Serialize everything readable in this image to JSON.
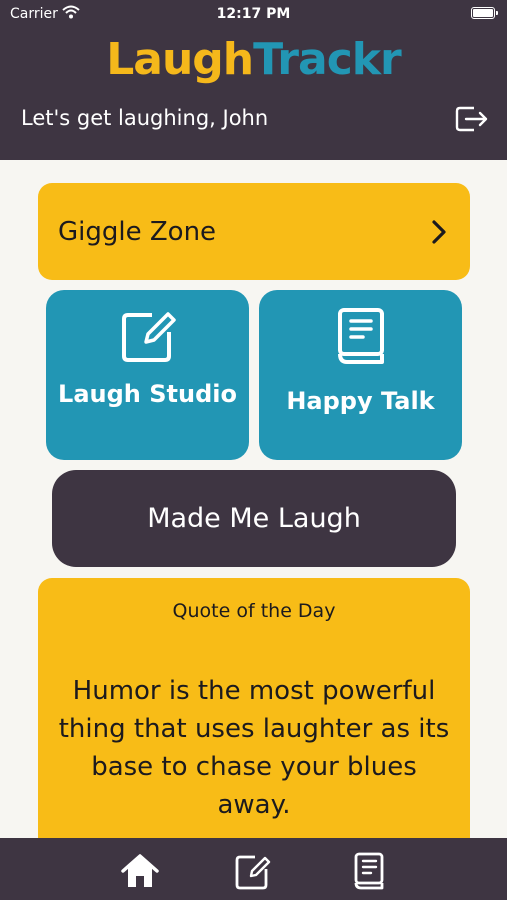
{
  "status_bar": {
    "carrier": "Carrier",
    "time": "12:17 PM",
    "icons": [
      "wifi-icon",
      "battery-icon"
    ]
  },
  "header": {
    "logo": {
      "part1": "Laugh",
      "part2": "Trackr"
    },
    "greeting": "Let's get laughing, John",
    "logout_icon": "logout-icon"
  },
  "giggle_zone": {
    "label": "Giggle Zone",
    "icon": "chevron-right-icon"
  },
  "tiles": [
    {
      "label": "Laugh Studio",
      "icon": "edit-icon"
    },
    {
      "label": "Happy Talk",
      "icon": "book-icon"
    }
  ],
  "made_me_laugh": {
    "label": "Made Me Laugh"
  },
  "quote": {
    "title": "Quote of the Day",
    "text": "Humor is the most powerful thing that uses laughter as its base to chase your blues away."
  },
  "tab_bar": {
    "items": [
      "home-icon",
      "edit-icon",
      "book-icon"
    ]
  },
  "colors": {
    "header": "#3e3542",
    "yellow": "#f8bc17",
    "teal": "#2296b4",
    "background": "#f7f6f2"
  }
}
